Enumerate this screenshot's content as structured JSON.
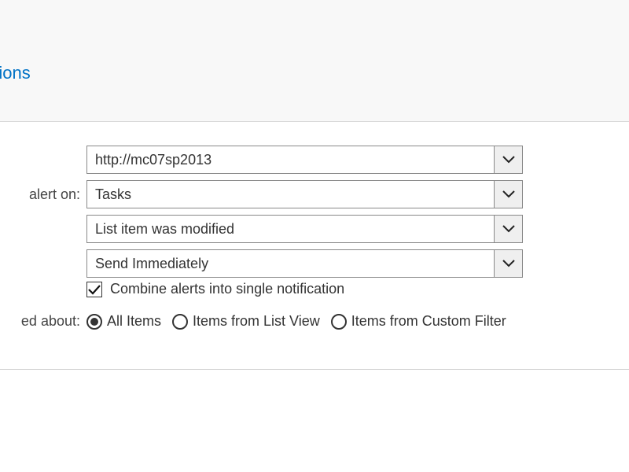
{
  "header": {
    "link_partial": "ptions"
  },
  "labels": {
    "alert_on_partial": "alert on:",
    "about_partial": "ed about:"
  },
  "dropdowns": {
    "site": "http://mc07sp2013",
    "list": "Tasks",
    "event": "List item was modified",
    "timing": "Send Immediately"
  },
  "checkbox": {
    "combine_label": "Combine alerts into single notification",
    "combine_checked": true
  },
  "radios": {
    "all_items": "All Items",
    "from_list_view": "Items from List View",
    "from_custom_filter": "Items from Custom Filter",
    "selected": "all_items"
  }
}
